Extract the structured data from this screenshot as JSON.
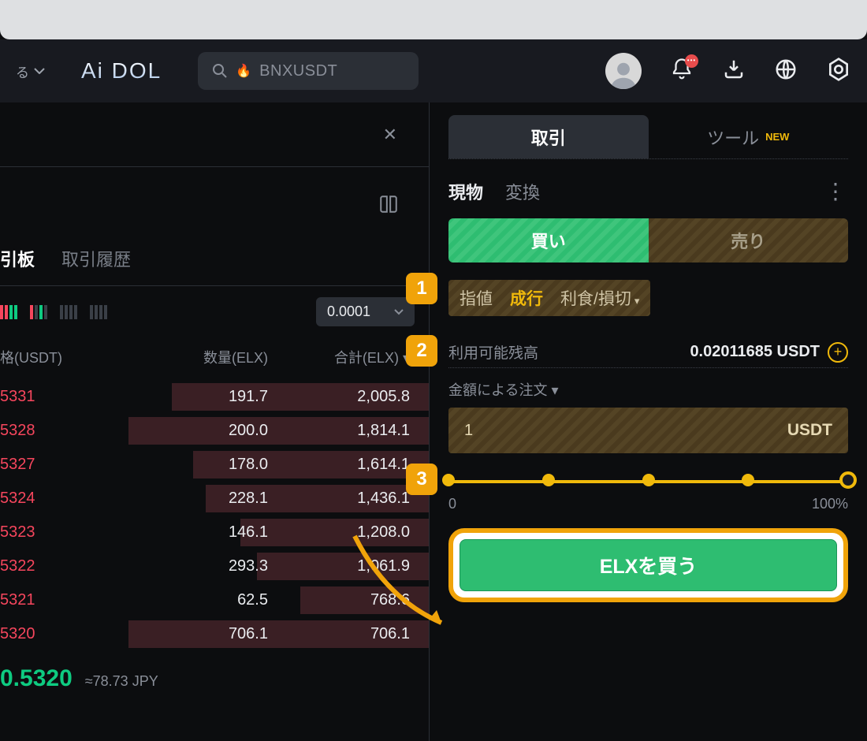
{
  "header": {
    "dropdown_label": "る",
    "logo": "Ai DOL",
    "search_pair": "BNXUSDT",
    "search_emoji": "🔥"
  },
  "left": {
    "tabs": {
      "orderbook": "引板",
      "history": "取引履歴"
    },
    "depth_select": "0.0001",
    "columns": {
      "price": "格(USDT)",
      "qty": "数量(ELX)",
      "total": "合計(ELX)"
    },
    "rows": [
      {
        "price": "5331",
        "qty": "191.7",
        "total": "2,005.8",
        "depth": 60
      },
      {
        "price": "5328",
        "qty": "200.0",
        "total": "1,814.1",
        "depth": 70
      },
      {
        "price": "5327",
        "qty": "178.0",
        "total": "1,614.1",
        "depth": 55
      },
      {
        "price": "5324",
        "qty": "228.1",
        "total": "1,436.1",
        "depth": 52
      },
      {
        "price": "5323",
        "qty": "146.1",
        "total": "1,208.0",
        "depth": 44
      },
      {
        "price": "5322",
        "qty": "293.3",
        "total": "1,061.9",
        "depth": 40
      },
      {
        "price": "5321",
        "qty": "62.5",
        "total": "768.6",
        "depth": 30
      },
      {
        "price": "5320",
        "qty": "706.1",
        "total": "706.1",
        "depth": 70
      }
    ],
    "last_price": "0.5320",
    "approx": "≈78.73 JPY"
  },
  "right": {
    "trade_tabs": {
      "trade": "取引",
      "tools": "ツール",
      "new_badge": "NEW"
    },
    "spot_tabs": {
      "spot": "現物",
      "convert": "変換"
    },
    "buysell": {
      "buy": "買い",
      "sell": "売り"
    },
    "order_types": {
      "limit": "指値",
      "market": "成行",
      "stop": "利食/損切"
    },
    "balance": {
      "label": "利用可能残高",
      "value": "0.02011685 USDT"
    },
    "order_by": "金額による注文 ▾",
    "amount": {
      "value": "1",
      "unit": "USDT"
    },
    "slider": {
      "min": "0",
      "max": "100%"
    },
    "buy_button": "ELXを買う"
  },
  "annotations": {
    "one": "1",
    "two": "2",
    "three": "3"
  }
}
